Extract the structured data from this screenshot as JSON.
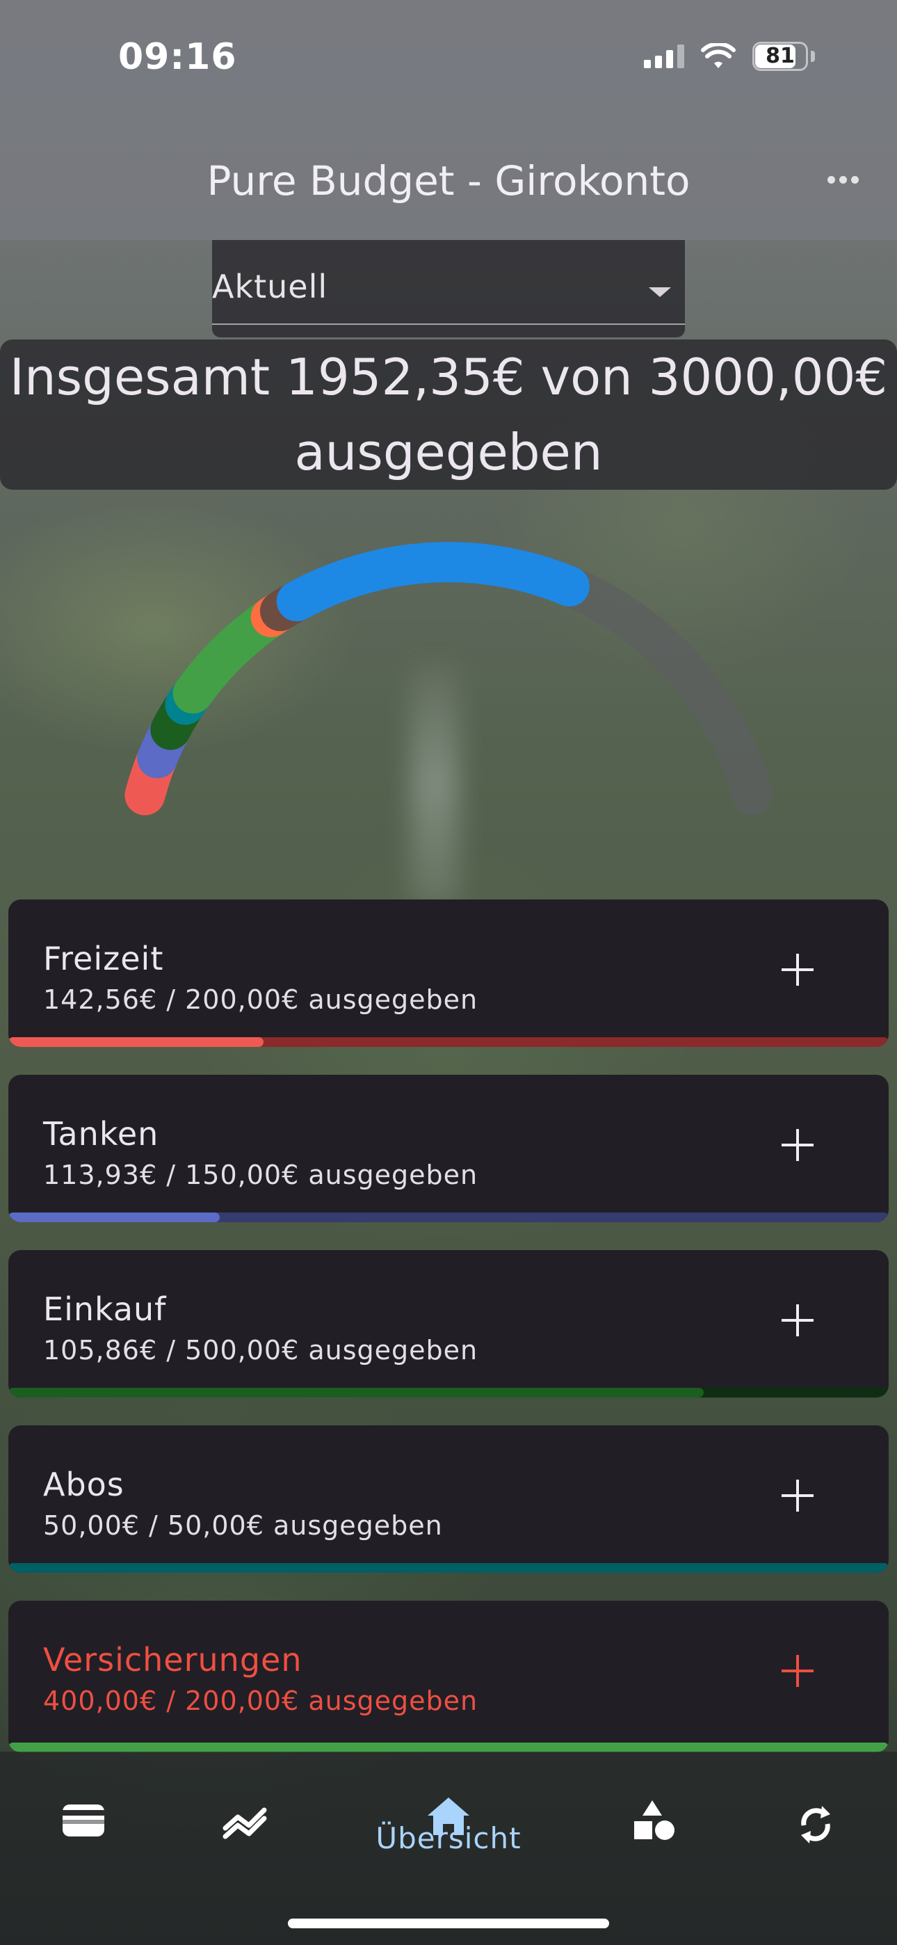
{
  "status_bar": {
    "time": "09:16",
    "battery": "81",
    "battery_level": 0.81
  },
  "header": {
    "title": "Pure Budget - Girokonto",
    "more_icon": "more-horizontal-icon"
  },
  "period_select": {
    "selected": "Aktuell"
  },
  "summary": {
    "line1": "Insgesamt 1952,35€ von 3000,00€",
    "line2": "ausgegeben"
  },
  "gauge": {
    "total_budget": 3000.0,
    "segments": [
      {
        "category": "Freizeit",
        "amount": 142.56,
        "color": "#ee5a53"
      },
      {
        "category": "Tanken",
        "amount": 113.93,
        "color": "#5b6bc6"
      },
      {
        "category": "Einkauf",
        "amount": 105.86,
        "color": "#1b5e20"
      },
      {
        "category": "Abos",
        "amount": 50.0,
        "color": "#00838f"
      },
      {
        "category": "Versicherungen",
        "amount": 400.0,
        "color": "#43a047"
      },
      {
        "category": "",
        "amount": 40.0,
        "color": "#ff6e40"
      },
      {
        "category": "",
        "amount": 70.0,
        "color": "#6d4c41"
      },
      {
        "category": "",
        "amount": 1030.0,
        "color": "#1e88e5"
      }
    ],
    "track_color": "#5c5f60"
  },
  "categories": [
    {
      "name": "Freizeit",
      "amount_text": "142,56€ / 200,00€ ausgegeben",
      "spent_fraction": 0.29,
      "bar_color": "#ee5a53",
      "track_color": "#8a2a2a",
      "over": false
    },
    {
      "name": "Tanken",
      "amount_text": "113,93€ / 150,00€ ausgegeben",
      "spent_fraction": 0.24,
      "bar_color": "#5b6bc6",
      "track_color": "#353c6e",
      "over": false
    },
    {
      "name": "Einkauf",
      "amount_text": "105,86€ / 500,00€ ausgegeben",
      "spent_fraction": 0.79,
      "bar_color": "#1b5e20",
      "track_color": "#0f2d12",
      "over": false
    },
    {
      "name": "Abos",
      "amount_text": "50,00€ / 50,00€ ausgegeben",
      "spent_fraction": 1.0,
      "bar_color": "#006064",
      "track_color": "#003a3c",
      "over": false
    },
    {
      "name": "Versicherungen",
      "amount_text": "400,00€ / 200,00€ ausgegeben",
      "spent_fraction": 1.0,
      "bar_color": "#43a047",
      "track_color": "#2a4a2c",
      "over": true
    }
  ],
  "nav": {
    "items": [
      {
        "icon": "wallet-icon",
        "label": ""
      },
      {
        "icon": "trend-chart-icon",
        "label": ""
      },
      {
        "icon": "home-icon",
        "label": "Übersicht"
      },
      {
        "icon": "shapes-icon",
        "label": ""
      },
      {
        "icon": "sync-icon",
        "label": ""
      }
    ],
    "active_color": "#a9d4fb"
  }
}
